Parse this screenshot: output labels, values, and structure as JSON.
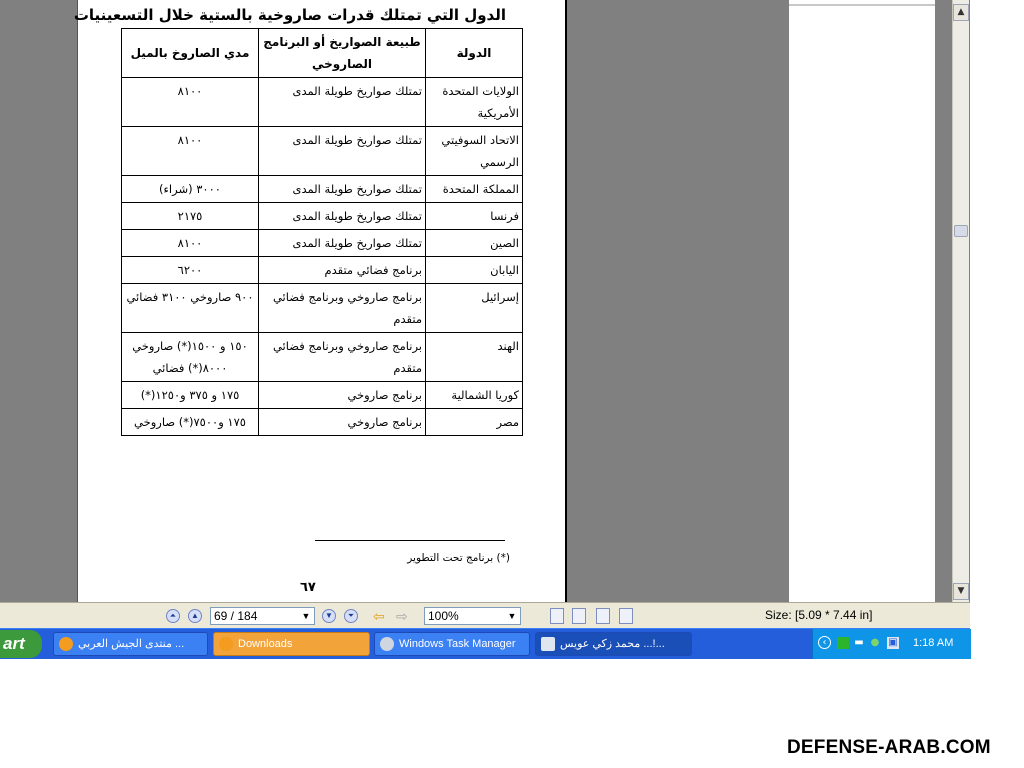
{
  "document": {
    "title": "الدول التي تمتلك قدرات صاروخية بالستية خلال التسعينيات",
    "table": {
      "headers": {
        "country": "الدولة",
        "nature": "طبيعة الصواريخ أو البرنامج الصاروخي",
        "range": "مدي الصاروخ بالميل"
      },
      "rows": [
        {
          "country": "الولايات المتحدة الأمريكية",
          "nature": "تمتلك صواريخ طويلة المدى",
          "range": "٨١٠٠"
        },
        {
          "country": "الاتحاد السوفيتي الرسمي",
          "nature": "تمتلك صواريخ طويلة المدى",
          "range": "٨١٠٠"
        },
        {
          "country": "المملكة المتحدة",
          "nature": "تمتلك صواريخ طويلة المدى",
          "range": "٣٠٠٠ (شراء)"
        },
        {
          "country": "فرنسا",
          "nature": "تمتلك صواريخ طويلة المدى",
          "range": "٢١٧٥"
        },
        {
          "country": "الصين",
          "nature": "تمتلك صواريخ طويلة المدى",
          "range": "٨١٠٠"
        },
        {
          "country": "اليابان",
          "nature": "برنامج فضائي متقدم",
          "range": "٦٢٠٠"
        },
        {
          "country": "إسرائيل",
          "nature": "برنامج صاروخي وبرنامج فضائي متقدم",
          "range": "٩٠٠ صاروخي ٣١٠٠ فضائي"
        },
        {
          "country": "الهند",
          "nature": "برنامج صاروخي وبرنامج فضائي متقدم",
          "range": "١٥٠ و ١٥٠٠(*) صاروخي ٨٠٠٠(*) فضائي"
        },
        {
          "country": "كوريا الشمالية",
          "nature": "برنامج صاروخي",
          "range": "١٧٥ و ٣٧٥ و١٢٥٠(*)"
        },
        {
          "country": "مصر",
          "nature": "برنامج صاروخي",
          "range": "١٧٥ و٧٥٠٠(*) صاروخي"
        }
      ]
    },
    "footnote": "(*) برنامج تحت التطوير",
    "page_number": "٦٧"
  },
  "statusbar": {
    "page_field": "69 / 184",
    "zoom_field": "100%",
    "page_size": "Size: [5.09 * 7.44 in]"
  },
  "taskbar": {
    "start_label": "art",
    "tasks": [
      {
        "label": "منتدى الجيش العربي ..."
      },
      {
        "label": "Downloads"
      },
      {
        "label": "Windows Task Manager"
      },
      {
        "label": "محمد زكي عويس ...!..."
      }
    ],
    "clock": "1:18 AM"
  },
  "watermark": "DEFENSE-ARAB.COM",
  "colors": {
    "viewer_bg": "#808080",
    "taskbar": "#245edb",
    "tray": "#0f95e8",
    "statusbar": "#ece9d8"
  }
}
